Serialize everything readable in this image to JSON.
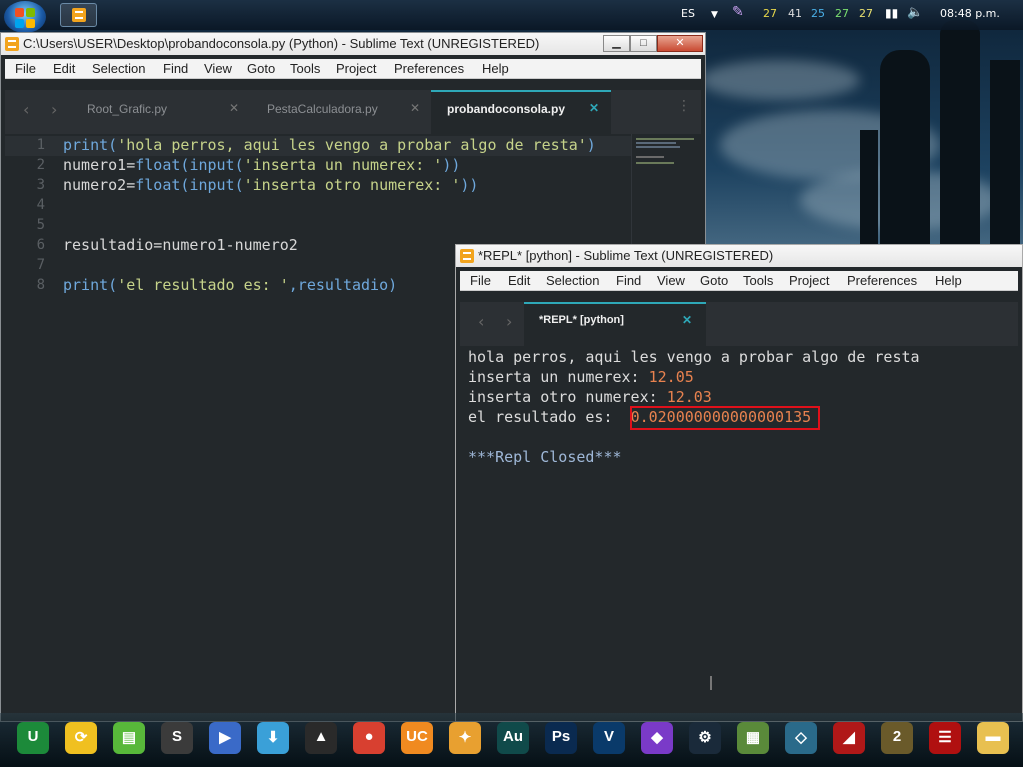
{
  "top_taskbar": {
    "language": "ES",
    "clock": "08:48 p.m.",
    "tray_counters": [
      {
        "value": "27",
        "color": "#e8d84a"
      },
      {
        "value": "41",
        "color": "#dddddd"
      },
      {
        "value": "25",
        "color": "#4ab0e8"
      },
      {
        "value": "27",
        "color": "#7be070"
      },
      {
        "value": "27",
        "color": "#e8e070"
      }
    ]
  },
  "editor_window": {
    "title": "C:\\Users\\USER\\Desktop\\probandoconsola.py (Python) - Sublime Text (UNREGISTERED)",
    "menu": [
      "File",
      "Edit",
      "Selection",
      "Find",
      "View",
      "Goto",
      "Tools",
      "Project",
      "Preferences",
      "Help"
    ],
    "tabs": [
      {
        "label": "Root_Grafic.py",
        "active": false
      },
      {
        "label": "PestaCalculadora.py",
        "active": false
      },
      {
        "label": "probandoconsola.py",
        "active": true
      }
    ],
    "line_numbers": [
      "1",
      "2",
      "3",
      "4",
      "5",
      "6",
      "7",
      "8"
    ],
    "code": {
      "l1_fn": "print",
      "l1_open": "(",
      "l1_str": "'hola perros, aqui les vengo a probar algo de resta'",
      "l1_close": ")",
      "l2_var": "numero1=",
      "l2_f1": "float",
      "l2_p1": "(",
      "l2_f2": "input",
      "l2_p2": "(",
      "l2_str": "'inserta un numerex: '",
      "l2_close": "))",
      "l3_var": "numero2=",
      "l3_f1": "float",
      "l3_p1": "(",
      "l3_f2": "input",
      "l3_p2": "(",
      "l3_str": "'inserta otro numerex: '",
      "l3_close": "))",
      "l6": "resultadio=numero1-numero2",
      "l8_fn": "print",
      "l8_open": "(",
      "l8_str": "'el resultado es: '",
      "l8_rest": ",resultadio)"
    }
  },
  "repl_window": {
    "title": "*REPL* [python] - Sublime Text (UNREGISTERED)",
    "menu": [
      "File",
      "Edit",
      "Selection",
      "Find",
      "View",
      "Goto",
      "Tools",
      "Project",
      "Preferences",
      "Help"
    ],
    "tab": "*REPL* [python]",
    "output": {
      "line1": "hola perros, aqui les vengo a probar algo de resta",
      "line2_label": "inserta un numerex: ",
      "line2_value": "12.05",
      "line3_label": "inserta otro numerex: ",
      "line3_value": "12.03",
      "line4_label": "el resultado es:  ",
      "line4_value": "0.020000000000000135",
      "closed": "***Repl Closed***"
    }
  },
  "dock": [
    {
      "name": "upwork-icon",
      "color": "#1c8a3a",
      "glyph": "U"
    },
    {
      "name": "sync-icon",
      "color": "#f0c020",
      "glyph": "⟳"
    },
    {
      "name": "app-store-icon",
      "color": "#58b83a",
      "glyph": "▤"
    },
    {
      "name": "sublime-text-icon",
      "color": "#3b3b3b",
      "glyph": "S"
    },
    {
      "name": "media-player-icon",
      "color": "#3a6ac8",
      "glyph": "▶"
    },
    {
      "name": "internet-download-icon",
      "color": "#3aa0d8",
      "glyph": "⬇"
    },
    {
      "name": "aimp-icon",
      "color": "#2a2a2a",
      "glyph": "▲"
    },
    {
      "name": "chrome-icon",
      "color": "#d84030",
      "glyph": "●"
    },
    {
      "name": "uc-browser-icon",
      "color": "#f08a20",
      "glyph": "UC"
    },
    {
      "name": "fl-studio-icon",
      "color": "#e8a030",
      "glyph": "✦"
    },
    {
      "name": "audition-icon",
      "color": "#104a4a",
      "glyph": "Au"
    },
    {
      "name": "photoshop-icon",
      "color": "#0a2a50",
      "glyph": "Ps"
    },
    {
      "name": "vegas-icon",
      "color": "#0a3a6a",
      "glyph": "V"
    },
    {
      "name": "pentagon-app-icon",
      "color": "#7a3ac8",
      "glyph": "◆"
    },
    {
      "name": "steam-icon",
      "color": "#1a2a3a",
      "glyph": "⚙"
    },
    {
      "name": "minecraft-icon",
      "color": "#5a8a3a",
      "glyph": "▦"
    },
    {
      "name": "crystal-icon",
      "color": "#2a6a8a",
      "glyph": "◇"
    },
    {
      "name": "dota2-icon",
      "color": "#b01818",
      "glyph": "◢"
    },
    {
      "name": "left4dead2-icon",
      "color": "#6a5a2a",
      "glyph": "2"
    },
    {
      "name": "ccleaner-icon",
      "color": "#b01010",
      "glyph": "☰"
    },
    {
      "name": "folder-icon",
      "color": "#e8c050",
      "glyph": "▬"
    }
  ]
}
